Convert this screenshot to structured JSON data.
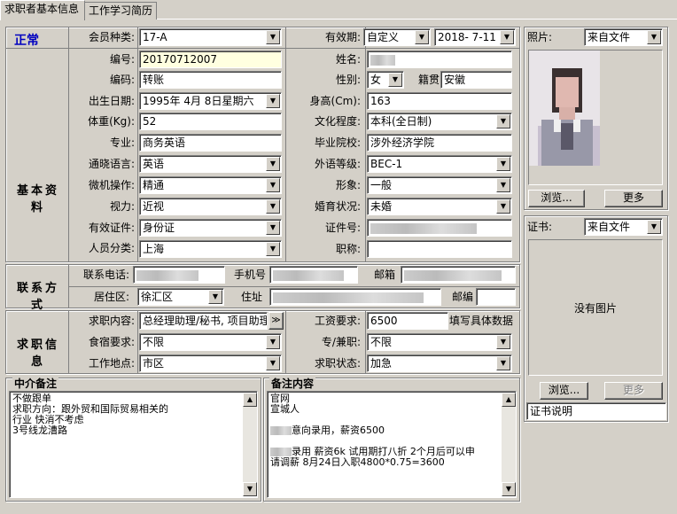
{
  "tabs": [
    {
      "label": "求职者基本信息"
    },
    {
      "label": "工作学习简历"
    }
  ],
  "status": "正常",
  "basic": {
    "section": "基本资料",
    "member_type": {
      "label": "会员种类:",
      "value": "17-A"
    },
    "validity": {
      "label": "有效期:",
      "type": "自定义",
      "date": "2018- 7-11"
    },
    "number": {
      "label": "编号:",
      "value": "20170712007"
    },
    "name": {
      "label": "姓名:"
    },
    "code": {
      "label": "编码:",
      "value": "转账"
    },
    "gender": {
      "label": "性别:",
      "value": "女"
    },
    "native": {
      "label": "籍贯",
      "value": "安徽"
    },
    "birth": {
      "label": "出生日期:",
      "value": "1995年 4月 8日星期六"
    },
    "height": {
      "label": "身高(Cm):",
      "value": "163"
    },
    "weight": {
      "label": "体重(Kg):",
      "value": "52"
    },
    "education": {
      "label": "文化程度:",
      "value": "本科(全日制)"
    },
    "major": {
      "label": "专业:",
      "value": "商务英语"
    },
    "school": {
      "label": "毕业院校:",
      "value": "涉外经济学院"
    },
    "language": {
      "label": "通晓语言:",
      "value": "英语"
    },
    "lang_level": {
      "label": "外语等级:",
      "value": "BEC-1"
    },
    "computer": {
      "label": "微机操作:",
      "value": "精通"
    },
    "image": {
      "label": "形象:",
      "value": "一般"
    },
    "vision": {
      "label": "视力:",
      "value": "近视"
    },
    "marital": {
      "label": "婚育状况:",
      "value": "未婚"
    },
    "id_doc": {
      "label": "有效证件:",
      "value": "身份证"
    },
    "id_no": {
      "label": "证件号:"
    },
    "category": {
      "label": "人员分类:",
      "value": "上海"
    },
    "title": {
      "label": "职称:",
      "value": ""
    }
  },
  "contact": {
    "section": "联系方式",
    "phone": {
      "label": "联系电话:"
    },
    "mobile": {
      "label": "手机号"
    },
    "email": {
      "label": "邮箱"
    },
    "district": {
      "label": "居住区:",
      "value": "徐汇区"
    },
    "address": {
      "label": "住址"
    },
    "zip": {
      "label": "邮编",
      "value": ""
    }
  },
  "job": {
    "section": "求职信息",
    "content": {
      "label": "求职内容:",
      "value": "总经理助理/秘书, 项目助理",
      "more": "≫"
    },
    "salary": {
      "label": "工资要求:",
      "value": "6500",
      "hint": "填写具体数据"
    },
    "lodging": {
      "label": "食宿要求:",
      "value": "不限"
    },
    "parttime": {
      "label": "专/兼职:",
      "value": "不限"
    },
    "location": {
      "label": "工作地点:",
      "value": "市区"
    },
    "state": {
      "label": "求职状态:",
      "value": "加急"
    }
  },
  "photo": {
    "label": "照片:",
    "source": "来自文件",
    "browse": "浏览...",
    "more": "更多"
  },
  "cert": {
    "label": "证书:",
    "source": "来自文件",
    "empty": "没有图片",
    "browse": "浏览...",
    "more": "更多",
    "desc": "证书说明"
  },
  "agency_note": {
    "title": "中介备注",
    "lines": [
      "不做跟单",
      "求职方向：跟外贸和国际贸易相关的",
      "行业 快消不考虑",
      "3号线龙漕路"
    ]
  },
  "remark": {
    "title": "备注内容",
    "lines": [
      "官网",
      "宣城人",
      "",
      "意向录用，薪资6500",
      "",
      "录用 薪资6k 试用期打八折 2个月后可以申",
      "请调薪 8月24日入职4800*0.75=3600"
    ]
  }
}
